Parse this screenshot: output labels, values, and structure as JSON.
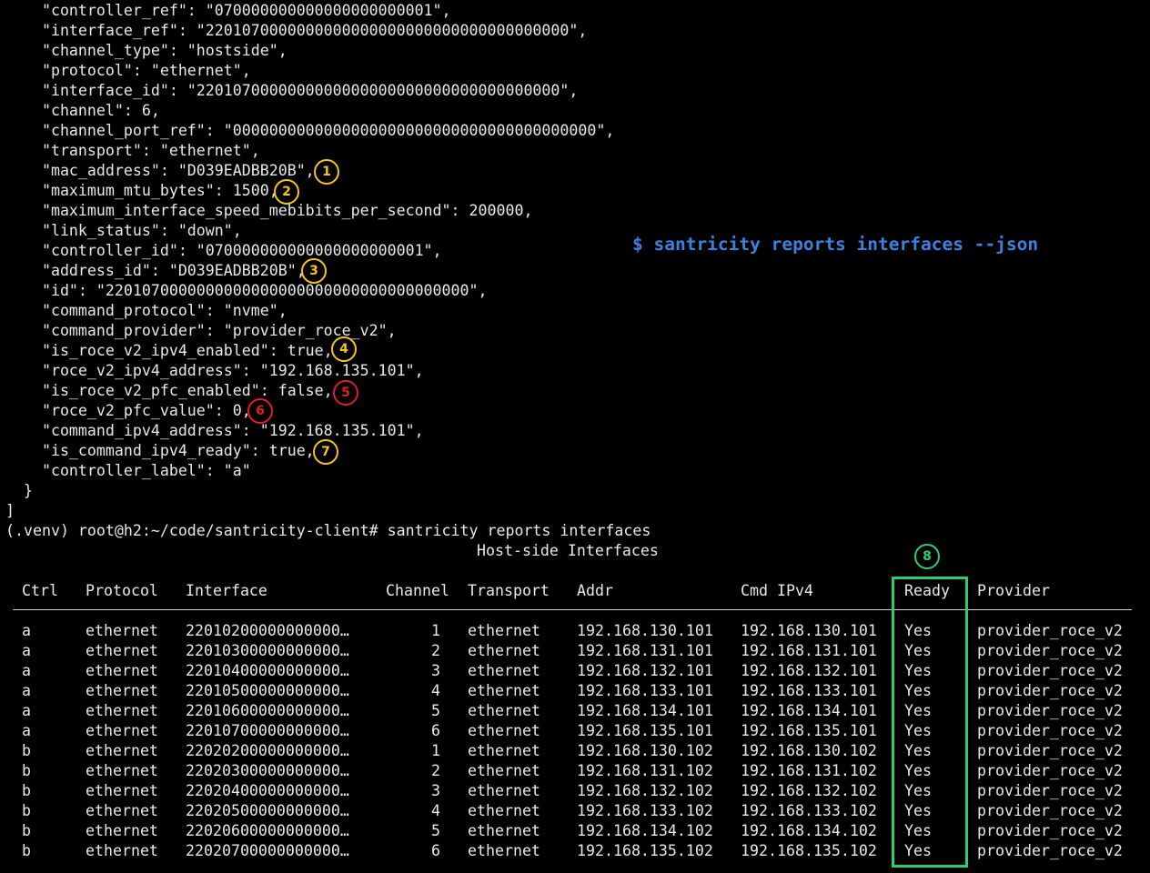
{
  "terminal": {
    "json_lines": [
      "    \"controller_ref\": \"070000000000000000000001\",",
      "    \"interface_ref\": \"2201070000000000000000000000000000000000\",",
      "    \"channel_type\": \"hostside\",",
      "    \"protocol\": \"ethernet\",",
      "    \"interface_id\": \"2201070000000000000000000000000000000000\",",
      "    \"channel\": 6,",
      "    \"channel_port_ref\": \"0000000000000000000000000000000000000000\",",
      "    \"transport\": \"ethernet\",",
      "    \"mac_address\": \"D039EADBB20B\",",
      "    \"maximum_mtu_bytes\": 1500,",
      "    \"maximum_interface_speed_mebibits_per_second\": 200000,",
      "    \"link_status\": \"down\",",
      "    \"controller_id\": \"070000000000000000000001\",",
      "    \"address_id\": \"D039EADBB20B\",",
      "    \"id\": \"2201070000000000000000000000000000000000\",",
      "    \"command_protocol\": \"nvme\",",
      "    \"command_provider\": \"provider_roce_v2\",",
      "    \"is_roce_v2_ipv4_enabled\": true,",
      "    \"roce_v2_ipv4_address\": \"192.168.135.101\",",
      "    \"is_roce_v2_pfc_enabled\": false,",
      "    \"roce_v2_pfc_value\": 0,",
      "    \"command_ipv4_address\": \"192.168.135.101\",",
      "    \"is_command_ipv4_ready\": true,",
      "    \"controller_label\": \"a\"",
      "  }",
      "]"
    ],
    "prompt_line": "(.venv) root@h2:~/code/santricity-client# santricity reports interfaces",
    "table_title": "Host-side Interfaces"
  },
  "annotation_command": "$ santricity reports interfaces --json",
  "badges": [
    "1",
    "2",
    "3",
    "4",
    "5",
    "6",
    "7",
    "8"
  ],
  "table": {
    "columns": [
      "Ctrl",
      "Protocol",
      "Interface",
      "Channel",
      "Transport",
      "Addr",
      "Cmd IPv4",
      "Ready",
      "Provider"
    ],
    "rows": [
      [
        "a",
        "ethernet",
        "22010200000000000…",
        "1",
        "ethernet",
        "192.168.130.101",
        "192.168.130.101",
        "Yes",
        "provider_roce_v2"
      ],
      [
        "a",
        "ethernet",
        "22010300000000000…",
        "2",
        "ethernet",
        "192.168.131.101",
        "192.168.131.101",
        "Yes",
        "provider_roce_v2"
      ],
      [
        "a",
        "ethernet",
        "22010400000000000…",
        "3",
        "ethernet",
        "192.168.132.101",
        "192.168.132.101",
        "Yes",
        "provider_roce_v2"
      ],
      [
        "a",
        "ethernet",
        "22010500000000000…",
        "4",
        "ethernet",
        "192.168.133.101",
        "192.168.133.101",
        "Yes",
        "provider_roce_v2"
      ],
      [
        "a",
        "ethernet",
        "22010600000000000…",
        "5",
        "ethernet",
        "192.168.134.101",
        "192.168.134.101",
        "Yes",
        "provider_roce_v2"
      ],
      [
        "a",
        "ethernet",
        "22010700000000000…",
        "6",
        "ethernet",
        "192.168.135.101",
        "192.168.135.101",
        "Yes",
        "provider_roce_v2"
      ],
      [
        "b",
        "ethernet",
        "22020200000000000…",
        "1",
        "ethernet",
        "192.168.130.102",
        "192.168.130.102",
        "Yes",
        "provider_roce_v2"
      ],
      [
        "b",
        "ethernet",
        "22020300000000000…",
        "2",
        "ethernet",
        "192.168.131.102",
        "192.168.131.102",
        "Yes",
        "provider_roce_v2"
      ],
      [
        "b",
        "ethernet",
        "22020400000000000…",
        "3",
        "ethernet",
        "192.168.132.102",
        "192.168.132.102",
        "Yes",
        "provider_roce_v2"
      ],
      [
        "b",
        "ethernet",
        "22020500000000000…",
        "4",
        "ethernet",
        "192.168.133.102",
        "192.168.133.102",
        "Yes",
        "provider_roce_v2"
      ],
      [
        "b",
        "ethernet",
        "22020600000000000…",
        "5",
        "ethernet",
        "192.168.134.102",
        "192.168.134.102",
        "Yes",
        "provider_roce_v2"
      ],
      [
        "b",
        "ethernet",
        "22020700000000000…",
        "6",
        "ethernet",
        "192.168.135.102",
        "192.168.135.102",
        "Yes",
        "provider_roce_v2"
      ]
    ]
  },
  "colors": {
    "background": "#000000",
    "text": "#e8e8e8",
    "annotation_blue": "#3b82e0",
    "badge_yellow": "#f5c518",
    "badge_red": "#e02020",
    "highlight_green": "#2ecc71"
  }
}
